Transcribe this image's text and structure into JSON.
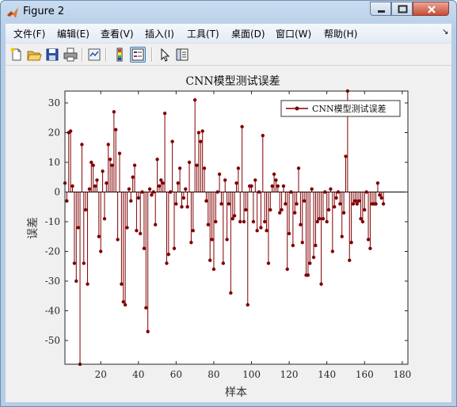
{
  "window": {
    "title": "Figure 2"
  },
  "menu": {
    "items": [
      "文件(F)",
      "编辑(E)",
      "查看(V)",
      "插入(I)",
      "工具(T)",
      "桌面(D)",
      "窗口(W)",
      "帮助(H)"
    ]
  },
  "toolbar": {
    "icons": [
      "new-figure-icon",
      "open-file-icon",
      "save-icon",
      "print-icon",
      "link-plot-icon",
      "colorbar-icon",
      "legend-icon",
      "pointer-icon",
      "property-editor-icon"
    ]
  },
  "chart_data": {
    "type": "stem",
    "title": "CNN模型测试误差",
    "xlabel": "样本",
    "ylabel": "误差",
    "xlim": [
      1,
      183
    ],
    "ylim": [
      -58,
      34
    ],
    "xticks": [
      20,
      40,
      60,
      80,
      100,
      120,
      140,
      160,
      180
    ],
    "yticks": [
      30,
      20,
      10,
      0,
      -10,
      -20,
      -30,
      -40,
      -50
    ],
    "legend": {
      "label": "CNN模型测试误差",
      "location": "top-right"
    },
    "series_color": "#800000",
    "values": [
      3,
      -3,
      20,
      20.5,
      2,
      -24,
      -30,
      -12,
      -58,
      16,
      -24,
      -6,
      -31,
      1,
      10,
      9,
      2,
      4,
      -15,
      -20,
      7,
      -9,
      3,
      16,
      11,
      9,
      27,
      21,
      -16,
      13,
      -31,
      -37,
      -38,
      -12,
      1,
      -3,
      5,
      9,
      -13,
      -2,
      -14,
      0,
      -19,
      -39,
      -47,
      1,
      -1,
      0,
      -11,
      11,
      2,
      4,
      3,
      26.5,
      -24,
      -21,
      0,
      17,
      -19,
      -4,
      3,
      8,
      -5,
      -2,
      1,
      -5,
      10,
      -17,
      -13,
      31,
      9,
      20,
      17,
      20.5,
      8,
      -3,
      -11,
      -23,
      -16,
      -26,
      -10,
      0,
      6,
      -4,
      -24,
      4,
      -16,
      -4,
      -34,
      -9,
      -8,
      3,
      8,
      -10,
      22,
      -10,
      -6,
      -38,
      2,
      2,
      -10,
      4,
      -13,
      0,
      -12,
      19,
      -10,
      -13,
      -24,
      -6,
      2,
      6,
      4,
      2,
      -7,
      -6,
      2,
      -4,
      -26,
      -14,
      0,
      -18,
      -7,
      -4,
      8,
      -11,
      -17,
      -3,
      -28,
      -28,
      -24,
      1,
      -22,
      -18,
      -10,
      -9,
      -31,
      -9,
      0,
      -10,
      -6,
      1,
      -20,
      -5,
      -2,
      0,
      -4,
      -15,
      -7,
      12,
      34,
      -23,
      -17,
      -4,
      -3,
      -4,
      -3,
      -9,
      -10,
      -6,
      0,
      -16,
      -19,
      -4,
      -4,
      -4,
      3,
      -1,
      -2,
      -4
    ]
  }
}
